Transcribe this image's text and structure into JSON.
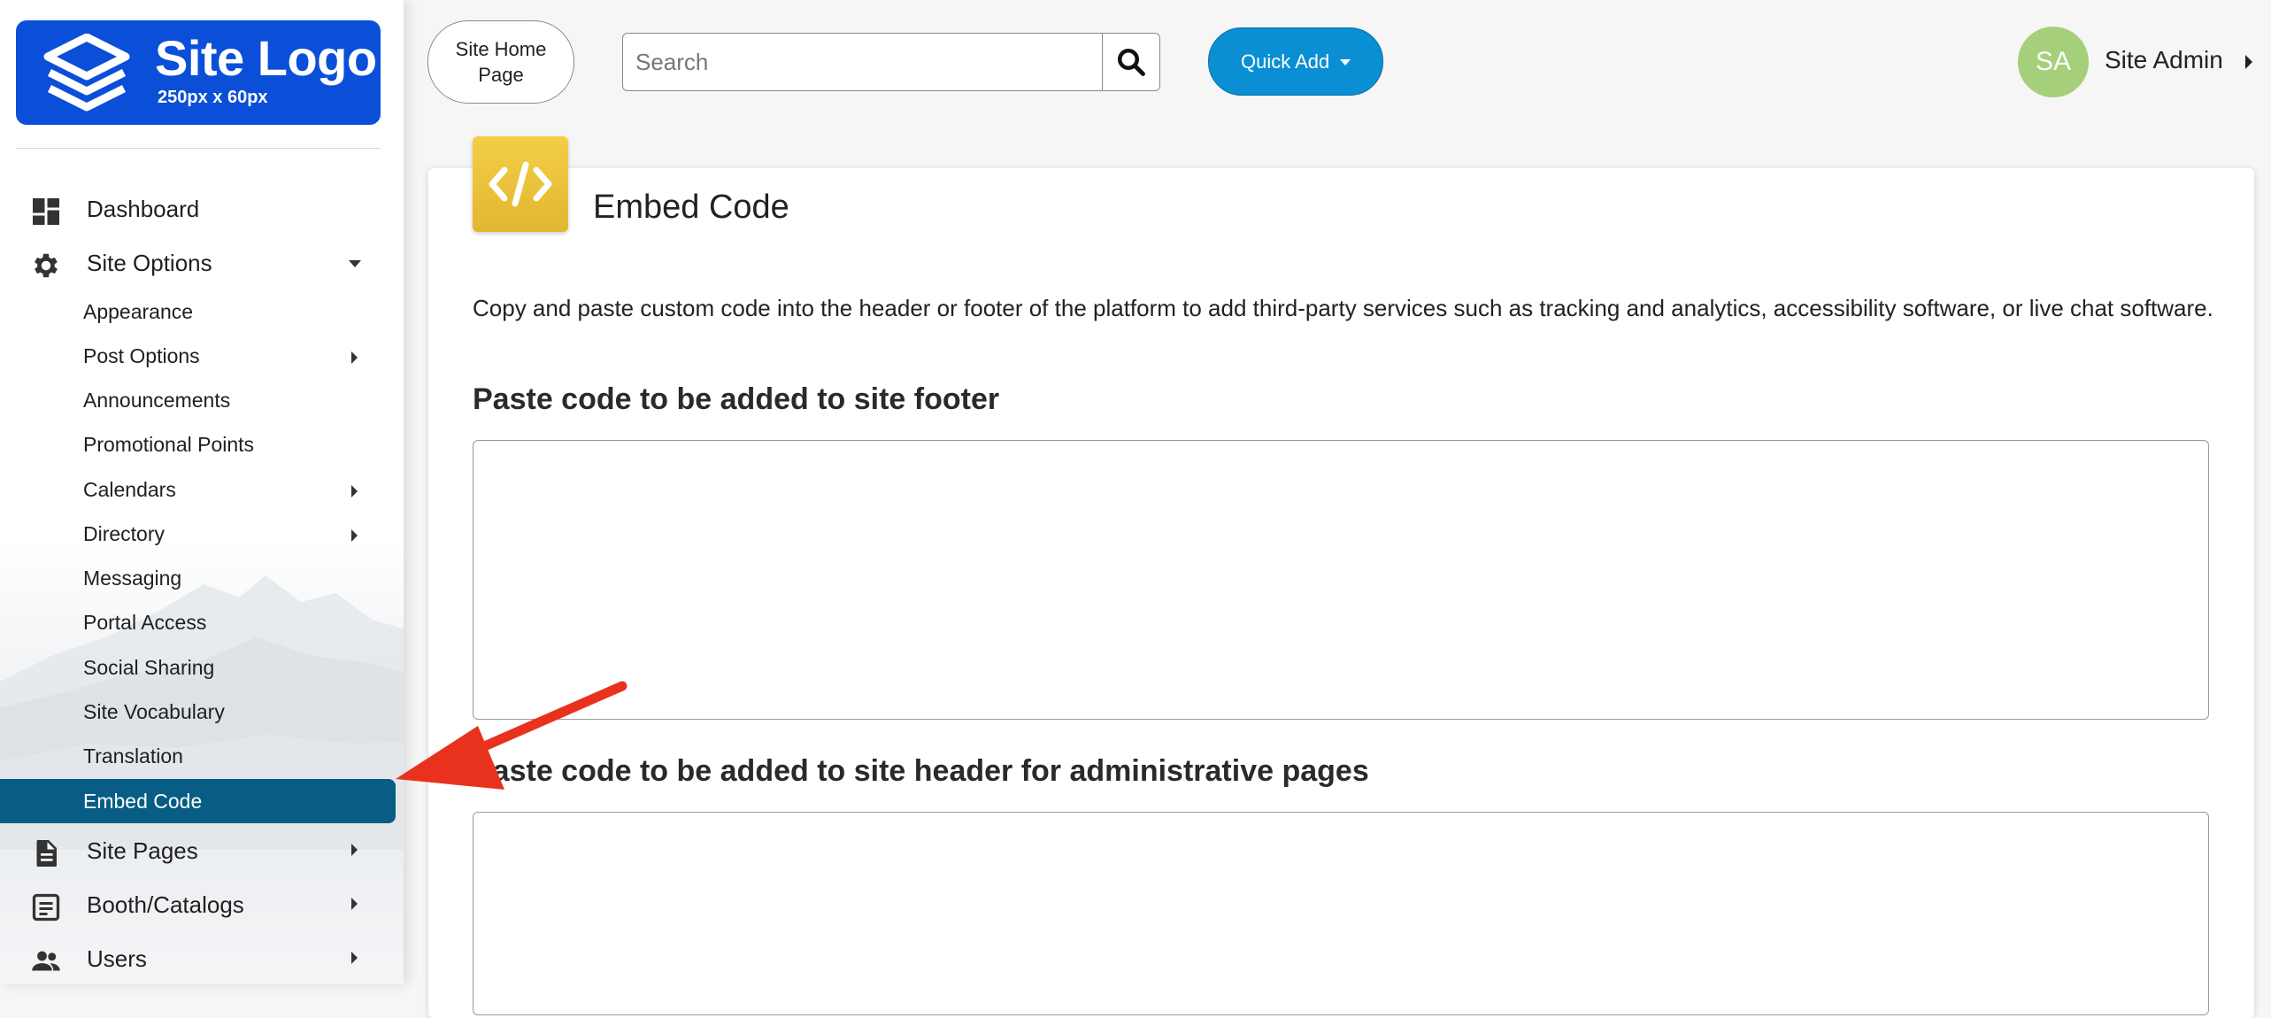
{
  "logo": {
    "title": "Site Logo",
    "subtitle": "250px x 60px",
    "bg_color": "#0b4fd9"
  },
  "sidebar": {
    "top_items": [
      {
        "label": "Dashboard",
        "icon": "dashboard-icon"
      },
      {
        "label": "Site Options",
        "icon": "gear-icon",
        "expanded": true
      }
    ],
    "sub_items": [
      {
        "label": "Appearance"
      },
      {
        "label": "Post Options",
        "has_children": true
      },
      {
        "label": "Announcements"
      },
      {
        "label": "Promotional Points"
      },
      {
        "label": "Calendars",
        "has_children": true
      },
      {
        "label": "Directory",
        "has_children": true
      },
      {
        "label": "Messaging"
      },
      {
        "label": "Portal Access"
      },
      {
        "label": "Social Sharing"
      },
      {
        "label": "Site Vocabulary"
      },
      {
        "label": "Translation"
      },
      {
        "label": "Embed Code",
        "active": true
      }
    ],
    "bottom_items": [
      {
        "label": "Site Pages",
        "icon": "document-icon"
      },
      {
        "label": "Booth/Catalogs",
        "icon": "catalog-icon"
      },
      {
        "label": "Users",
        "icon": "users-icon"
      }
    ],
    "active_color": "#075d83"
  },
  "header": {
    "home_button": "Site Home Page",
    "search_placeholder": "Search",
    "quick_add": "Quick Add",
    "avatar_initials": "SA",
    "user_name": "Site Admin",
    "accent_color": "#0a8fd4"
  },
  "main": {
    "title": "Embed Code",
    "icon": "code-icon",
    "description": "Copy and paste custom code into the header or footer of the platform to add third-party services such as tracking and analytics, accessibility software, or live chat software.",
    "footer_heading": "Paste code to be added to site footer",
    "footer_value": "",
    "admin_header_heading": "Paste code to be added to site header for administrative pages",
    "admin_header_value": ""
  },
  "annotation": {
    "arrow_color": "#e8321e"
  }
}
